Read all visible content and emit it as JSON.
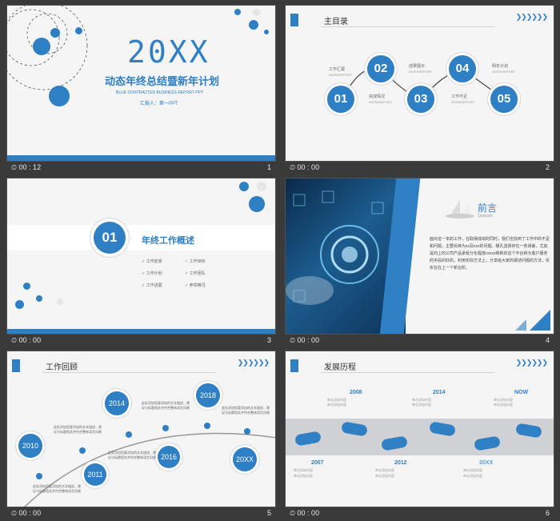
{
  "slides": [
    {
      "time": "00 : 12",
      "number": "1",
      "title": "20XX",
      "subtitle": "动态年终总结暨新年计划",
      "english": "BLUE CONTRACTED BUSINESS REPORT PPT",
      "reporter": "汇报人：第一PPT"
    },
    {
      "time": "00 : 00",
      "number": "2",
      "header": "主目录",
      "items": [
        {
          "num": "01",
          "label": "工作汇报",
          "sub": "WORKREPORT"
        },
        {
          "num": "02",
          "label": "完成情况",
          "sub": "WORKREPORT"
        },
        {
          "num": "03",
          "label": "成果展示",
          "sub": "WORKREPORT"
        },
        {
          "num": "04",
          "label": "工作不足",
          "sub": "WORKREPORT"
        },
        {
          "num": "05",
          "label": "明年计划",
          "sub": "WORKREPORT"
        }
      ]
    },
    {
      "time": "00 : 00",
      "number": "3",
      "num": "01",
      "heading": "年终工作概述",
      "bullets": [
        "工作前景",
        "工作计划",
        "工作进展",
        "工作目标",
        "工作团队",
        "参举精况"
      ]
    },
    {
      "time": "00 : 00",
      "number": "4",
      "heading": "前言",
      "sub": "Qianyan",
      "body": "面对这一年的工作，在取得成绩的同时，我们也找到了工作中的不足和问题，主要反映为xx及xxx的问题，瞳孔选择存在一些误差，尤其是向上的公司产品承受分化程度xxxxx和新的这个平台转为客户服务的手段的好的，利用实际方法上，分享给大家的阐述问题的方法，实实在在上一个新台阶。"
    },
    {
      "time": "00 : 00",
      "number": "5",
      "header": "工作回顾",
      "years": [
        "2010",
        "2011",
        "2014",
        "2016",
        "2018",
        "20XX"
      ],
      "note": "此处添加您要添加的文本描述，建议与标题相关并符合整体语言风格"
    },
    {
      "time": "00 : 00",
      "number": "6",
      "header": "发展历程",
      "top_years": [
        "2008",
        "2014",
        "NOW"
      ],
      "bottom_years": [
        "2007",
        "2012",
        "20XX"
      ],
      "note": "单击添加内容"
    }
  ],
  "colors": {
    "accent": "#2f7fc5",
    "bg": "#f5f5f5",
    "dark": "#3a3a3a"
  },
  "icons": {
    "clock": "clock-icon",
    "arrows": "chevron-arrows-icon"
  }
}
